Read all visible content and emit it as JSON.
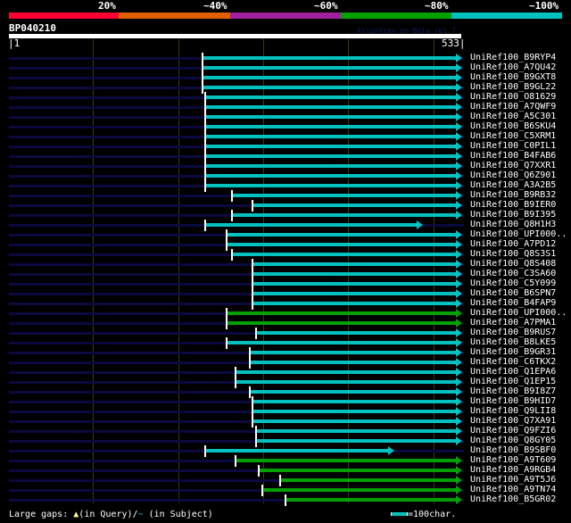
{
  "legend": {
    "labels": [
      "20%",
      "~40%",
      "~60%",
      "~80%",
      "~100%"
    ],
    "colors": [
      "#ff0033",
      "#e06000",
      "#a020a0",
      "#00a000",
      "#00c0c0"
    ]
  },
  "query": {
    "name": "BP040210",
    "start_label": "|1",
    "end_label": "533|",
    "length": 533
  },
  "version_text": "AlignView.pm Beta rel.7",
  "footer": {
    "gaps_label": "Large gaps:",
    "query_gap_symbol": "▲",
    "query_gap_text": "(in Query)/",
    "subject_gap_symbol": "~",
    "subject_gap_text": " (in Subject)",
    "scale_text": "=100char."
  },
  "track_color": "#0a0a40",
  "hits": [
    {
      "name": "UniRef100_B9RYP4",
      "start": 229,
      "end": 533,
      "color": "cyan"
    },
    {
      "name": "UniRef100_A7QU42",
      "start": 229,
      "end": 533,
      "color": "cyan"
    },
    {
      "name": "UniRef100_B9GXT8",
      "start": 229,
      "end": 533,
      "color": "cyan"
    },
    {
      "name": "UniRef100_B9GL22",
      "start": 229,
      "end": 533,
      "color": "cyan"
    },
    {
      "name": "UniRef100_O81629",
      "start": 232,
      "end": 533,
      "color": "cyan"
    },
    {
      "name": "UniRef100_A7QWF9",
      "start": 232,
      "end": 533,
      "color": "cyan"
    },
    {
      "name": "UniRef100_A5C301",
      "start": 232,
      "end": 533,
      "color": "cyan"
    },
    {
      "name": "UniRef100_B6SKU4",
      "start": 232,
      "end": 533,
      "color": "cyan"
    },
    {
      "name": "UniRef100_C5XRM1",
      "start": 232,
      "end": 533,
      "color": "cyan"
    },
    {
      "name": "UniRef100_C0PIL1",
      "start": 232,
      "end": 533,
      "color": "cyan"
    },
    {
      "name": "UniRef100_B4FAB6",
      "start": 232,
      "end": 533,
      "color": "cyan"
    },
    {
      "name": "UniRef100_Q7XXR1",
      "start": 232,
      "end": 533,
      "color": "cyan"
    },
    {
      "name": "UniRef100_Q6Z901",
      "start": 232,
      "end": 533,
      "color": "cyan"
    },
    {
      "name": "UniRef100_A3A2B5",
      "start": 232,
      "end": 533,
      "color": "cyan"
    },
    {
      "name": "UniRef100_B9RB32",
      "start": 263,
      "end": 533,
      "color": "cyan"
    },
    {
      "name": "UniRef100_B9IER0",
      "start": 287,
      "end": 533,
      "color": "cyan"
    },
    {
      "name": "UniRef100_B9I395",
      "start": 263,
      "end": 533,
      "color": "cyan"
    },
    {
      "name": "UniRef100_Q8H1H3",
      "start": 232,
      "end": 487,
      "color": "cyan"
    },
    {
      "name": "UniRef100_UPI000..",
      "start": 257,
      "end": 533,
      "color": "cyan"
    },
    {
      "name": "UniRef100_A7PD12",
      "start": 257,
      "end": 533,
      "color": "cyan"
    },
    {
      "name": "UniRef100_Q8S3S1",
      "start": 263,
      "end": 533,
      "color": "cyan"
    },
    {
      "name": "UniRef100_Q8S408",
      "start": 287,
      "end": 533,
      "color": "cyan"
    },
    {
      "name": "UniRef100_C3SA60",
      "start": 287,
      "end": 533,
      "color": "cyan"
    },
    {
      "name": "UniRef100_C5Y099",
      "start": 287,
      "end": 533,
      "color": "cyan"
    },
    {
      "name": "UniRef100_B6SPN7",
      "start": 287,
      "end": 533,
      "color": "cyan"
    },
    {
      "name": "UniRef100_B4FAP9",
      "start": 287,
      "end": 533,
      "color": "cyan"
    },
    {
      "name": "UniRef100_UPI000..",
      "start": 257,
      "end": 533,
      "color": "green"
    },
    {
      "name": "UniRef100_A7PMA1",
      "start": 257,
      "end": 533,
      "color": "green"
    },
    {
      "name": "UniRef100_B9RUS7",
      "start": 292,
      "end": 533,
      "color": "cyan"
    },
    {
      "name": "UniRef100_B8LKE5",
      "start": 257,
      "end": 533,
      "color": "cyan"
    },
    {
      "name": "UniRef100_B9GR31",
      "start": 284,
      "end": 533,
      "color": "cyan"
    },
    {
      "name": "UniRef100_C6TKX2",
      "start": 284,
      "end": 533,
      "color": "cyan"
    },
    {
      "name": "UniRef100_Q1EPA6",
      "start": 268,
      "end": 533,
      "color": "cyan"
    },
    {
      "name": "UniRef100_Q1EP15",
      "start": 268,
      "end": 533,
      "color": "cyan"
    },
    {
      "name": "UniRef100_B9I8Z7",
      "start": 284,
      "end": 533,
      "color": "cyan"
    },
    {
      "name": "UniRef100_B9HID7",
      "start": 287,
      "end": 533,
      "color": "cyan"
    },
    {
      "name": "UniRef100_Q9LII8",
      "start": 287,
      "end": 533,
      "color": "cyan"
    },
    {
      "name": "UniRef100_Q7XA91",
      "start": 287,
      "end": 533,
      "color": "cyan"
    },
    {
      "name": "UniRef100_Q9FZI6",
      "start": 292,
      "end": 533,
      "color": "cyan"
    },
    {
      "name": "UniRef100_Q8GY05",
      "start": 292,
      "end": 533,
      "color": "cyan"
    },
    {
      "name": "UniRef100_B9SBF0",
      "start": 232,
      "end": 453,
      "color": "cyan"
    },
    {
      "name": "UniRef100_A9T609",
      "start": 268,
      "end": 533,
      "color": "green"
    },
    {
      "name": "UniRef100_A9RGB4",
      "start": 295,
      "end": 533,
      "color": "green"
    },
    {
      "name": "UniRef100_A9T5J6",
      "start": 320,
      "end": 533,
      "color": "green"
    },
    {
      "name": "UniRef100_A9TN74",
      "start": 299,
      "end": 533,
      "color": "green"
    },
    {
      "name": "UniRef100_B5GR02",
      "start": 326,
      "end": 533,
      "color": "green"
    }
  ]
}
